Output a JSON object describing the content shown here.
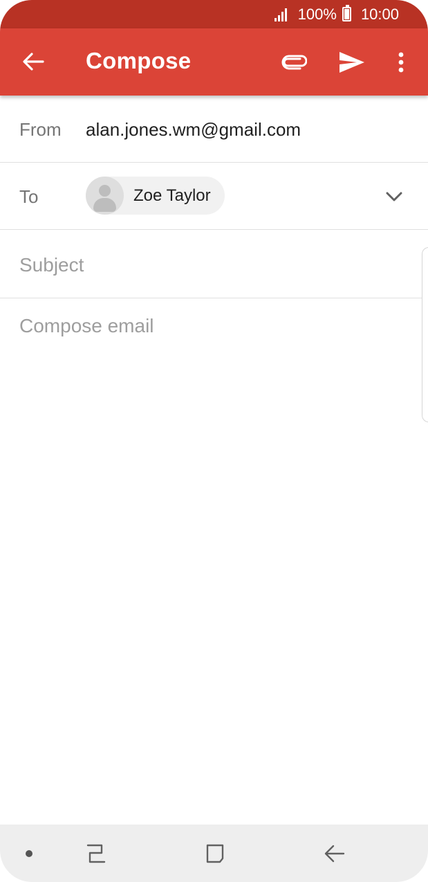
{
  "status_bar": {
    "battery_text": "100%",
    "time": "10:00",
    "icons": [
      "signal-icon",
      "battery-icon"
    ]
  },
  "app_bar": {
    "title": "Compose",
    "actions": [
      "back-arrow-icon",
      "attach-icon",
      "send-icon",
      "more-vert-icon"
    ]
  },
  "compose": {
    "from_label": "From",
    "from_value": "alan.jones.wm@gmail.com",
    "to_label": "To",
    "recipients": [
      {
        "name": "Zoe Taylor",
        "icon": "person-avatar-icon"
      }
    ],
    "subject_placeholder": "Subject",
    "body_placeholder": "Compose email"
  },
  "nav_bar": {
    "buttons": [
      "dot-icon",
      "recent-apps-icon",
      "home-icon",
      "back-icon"
    ]
  },
  "colors": {
    "status_bar": "#b83224",
    "app_bar": "#db4437",
    "nav_bar": "#eeeeee",
    "chip": "#f1f1f1"
  }
}
